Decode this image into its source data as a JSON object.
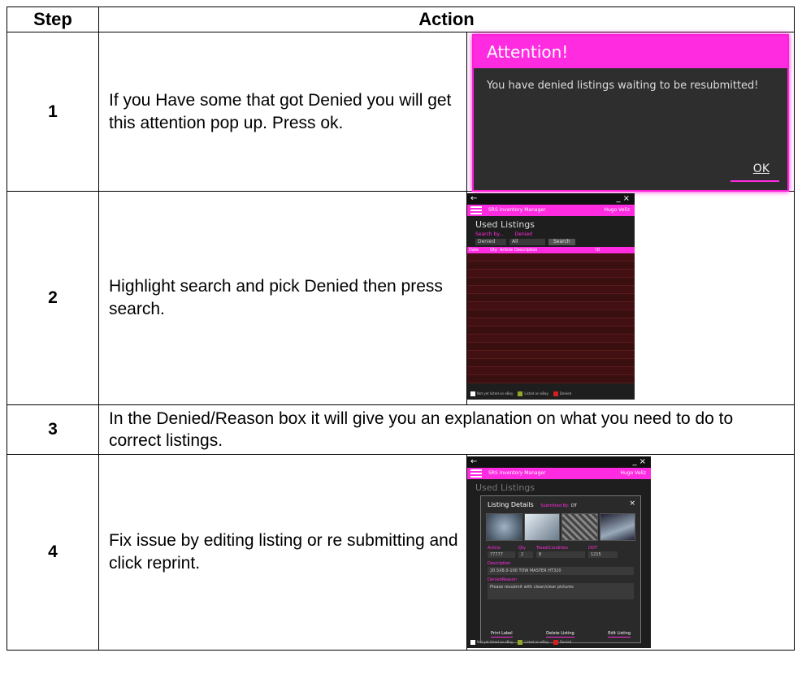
{
  "table": {
    "header_step": "Step",
    "header_action": "Action"
  },
  "steps": [
    {
      "num": "1",
      "text": "If you Have some that got Denied you will get this attention pop up. Press ok."
    },
    {
      "num": "2",
      "text": "Highlight search and pick Denied then press search."
    },
    {
      "num": "3",
      "text": "In the Denied/Reason box it will give you an explanation on what you need to do to correct listings."
    },
    {
      "num": "4",
      "text": "Fix issue by editing listing or re submitting and click reprint."
    }
  ],
  "attention_dialog": {
    "title": "Attention!",
    "message": "You have denied listings waiting to be resubmitted!",
    "ok_label": "OK"
  },
  "app": {
    "name": "SRS Inventory Manager",
    "user": "Hugo Veliz",
    "back_icon": "arrow-left-icon",
    "page_title": "Used Listings",
    "search_label": "Search by...",
    "search_value_label": "Denied",
    "search_select": "Denied",
    "search_input": "All",
    "search_button": "Search",
    "columns": [
      "Date",
      "Qty",
      "Article",
      "Description",
      "ID"
    ],
    "legend": [
      {
        "label": "Not yet listed on eBay",
        "color": "#ffffff"
      },
      {
        "label": "Listed on eBay",
        "color": "#8fa82a"
      },
      {
        "label": "Denied",
        "color": "#d42020"
      }
    ]
  },
  "listing_details": {
    "title": "Listing Details",
    "submitted_by_label": "Submitted By:",
    "submitted_by": "DT",
    "fields": {
      "article_label": "Article",
      "qty_label": "Qty",
      "tread_label": "Tread/Condition",
      "dot_label": "DOT",
      "article": "77777",
      "qty": "2",
      "tread": "8",
      "dot": "1215",
      "description_label": "Description",
      "description": "20.5X8.0-100 TOW MASTER HT320",
      "denied_reason_label": "DeniedReason",
      "denied_reason": "Please resubmit with clean/clear pictures"
    },
    "print_label": "Print Label",
    "delete_listing": "Delete Listing",
    "edit_listing": "Edit Listing"
  }
}
